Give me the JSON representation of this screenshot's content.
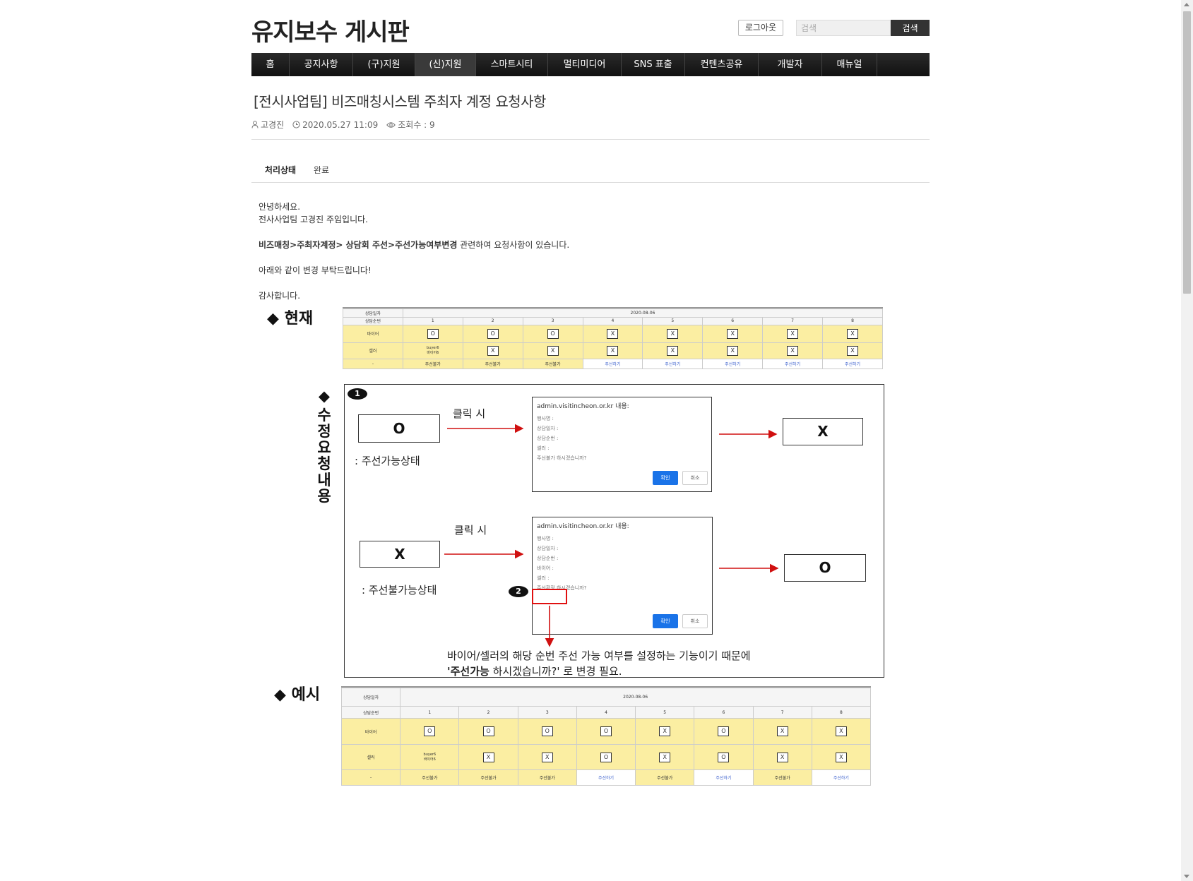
{
  "site": {
    "title": "유지보수 게시판"
  },
  "header": {
    "logout_label": "로그아웃",
    "search_placeholder": "검색",
    "search_button": "검색"
  },
  "nav": {
    "items": [
      "홈",
      "공지사항",
      "(구)지원",
      "(신)지원",
      "스마트시티",
      "멀티미디어",
      "SNS 표출",
      "컨텐츠공유",
      "개발자",
      "매뉴얼"
    ],
    "active_index": 3
  },
  "post": {
    "title": "[전시사업팀] 비즈매칭시스템 주최자 계정 요청사항",
    "author": "고경진",
    "date": "2020.05.27 11:09",
    "views_label": "조회수 : 9",
    "status_label": "처리상태",
    "status_value": "완료",
    "body": {
      "line1": "안녕하세요.",
      "line2": "전사사업팀 고경진 주임입니다.",
      "line3_bold": "비즈매칭>주최자계정> 상담회 주선>주선가능여부변경",
      "line3_rest": " 관련하여 요청사항이 있습니다.",
      "line4": "아래와 같이 변경 부탁드립니다!",
      "line5": "감사합니다."
    }
  },
  "figure": {
    "current_label": "◆ 현재",
    "request_label_vertical": "수정요청내용",
    "request_diamond": "◆",
    "example_label": "◆ 예시",
    "table_date": "2020-08-06",
    "table_row_labels": [
      "상담일자",
      "상담순번",
      "바이어",
      "셀러",
      "-"
    ],
    "seller_text": "buyer6\n바이어6",
    "columns": [
      "1",
      "2",
      "3",
      "4",
      "5",
      "6",
      "7",
      "8"
    ],
    "current_buyer": [
      "O",
      "O",
      "O",
      "X",
      "X",
      "X",
      "X",
      "X"
    ],
    "current_seller": [
      "",
      "X",
      "X",
      "X",
      "X",
      "X",
      "X",
      "X"
    ],
    "current_footer": [
      "주선불가",
      "주선불가",
      "주선불가",
      "주선하기",
      "주선하기",
      "주선하기",
      "주선하기",
      "주선하기"
    ],
    "example_buyer": [
      "O",
      "O",
      "O",
      "O",
      "X",
      "O",
      "X",
      "X"
    ],
    "example_seller": [
      "",
      "X",
      "X",
      "O",
      "X",
      "O",
      "X",
      "X"
    ],
    "example_footer": [
      "주선불가",
      "주선불가",
      "주선불가",
      "주선하기",
      "주선불가",
      "주선하기",
      "주선불가",
      "주선하기"
    ],
    "step1_badge": "1",
    "step2_badge": "2",
    "box_o": "O",
    "box_x": "X",
    "click_label": "클릭 시",
    "state_possible": ": 주선가능상태",
    "state_impossible": ": 주선불가능상태",
    "dialog_title": "admin.visitincheon.or.kr 내용:",
    "dialog1_lines": [
      "행사명 :",
      "상담일자 :",
      "상담순번 :",
      "셀러 :",
      "주선불가 하시겠습니까?"
    ],
    "dialog2_lines": [
      "행사명 :",
      "상담일자 :",
      "상담순번 :",
      "바이어 :",
      "셀러 :",
      "주선확정 하시겠습니까?"
    ],
    "dialog_ok": "확인",
    "dialog_cancel": "취소",
    "note_line1": "바이어/셀러의 해당 순번 주선 가능 여부를 설정하는 기능이기 때문에",
    "note_line2_bold": "'주선가능",
    "note_line2_rest": " 하시겠습니까?' 로 변경 필요."
  }
}
